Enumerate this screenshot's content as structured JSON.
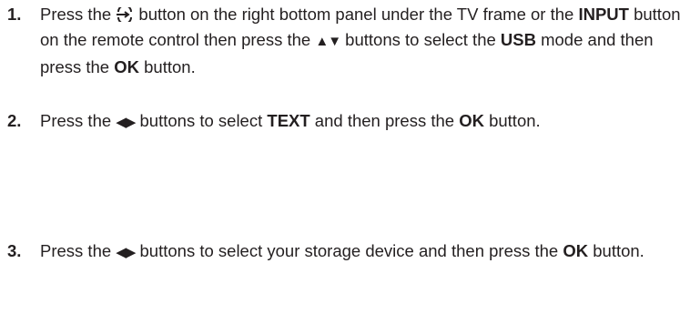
{
  "steps": [
    {
      "number": "1.",
      "t1": "Press the ",
      "t2": " button on the right bottom panel under the TV frame or the ",
      "input": "INPUT",
      "t3": " button on the remote control then press the ",
      "arrows": "▲▼",
      "t4": " buttons to select the ",
      "usb": "USB",
      "t5": " mode and then press the ",
      "ok": "OK",
      "t6": " button."
    },
    {
      "number": "2.",
      "t1": "Press the ",
      "arrows": "◀▶",
      "t2": " buttons to select ",
      "text_word": "TEXT",
      "t3": " and then press the ",
      "ok": "OK",
      "t4": " button."
    },
    {
      "number": "3.",
      "t1": "Press the ",
      "arrows": "◀▶",
      "t2": " buttons to select your storage device and then press the ",
      "ok": "OK",
      "t3": " button."
    }
  ],
  "icons": {
    "input_button": "input-source-icon"
  }
}
